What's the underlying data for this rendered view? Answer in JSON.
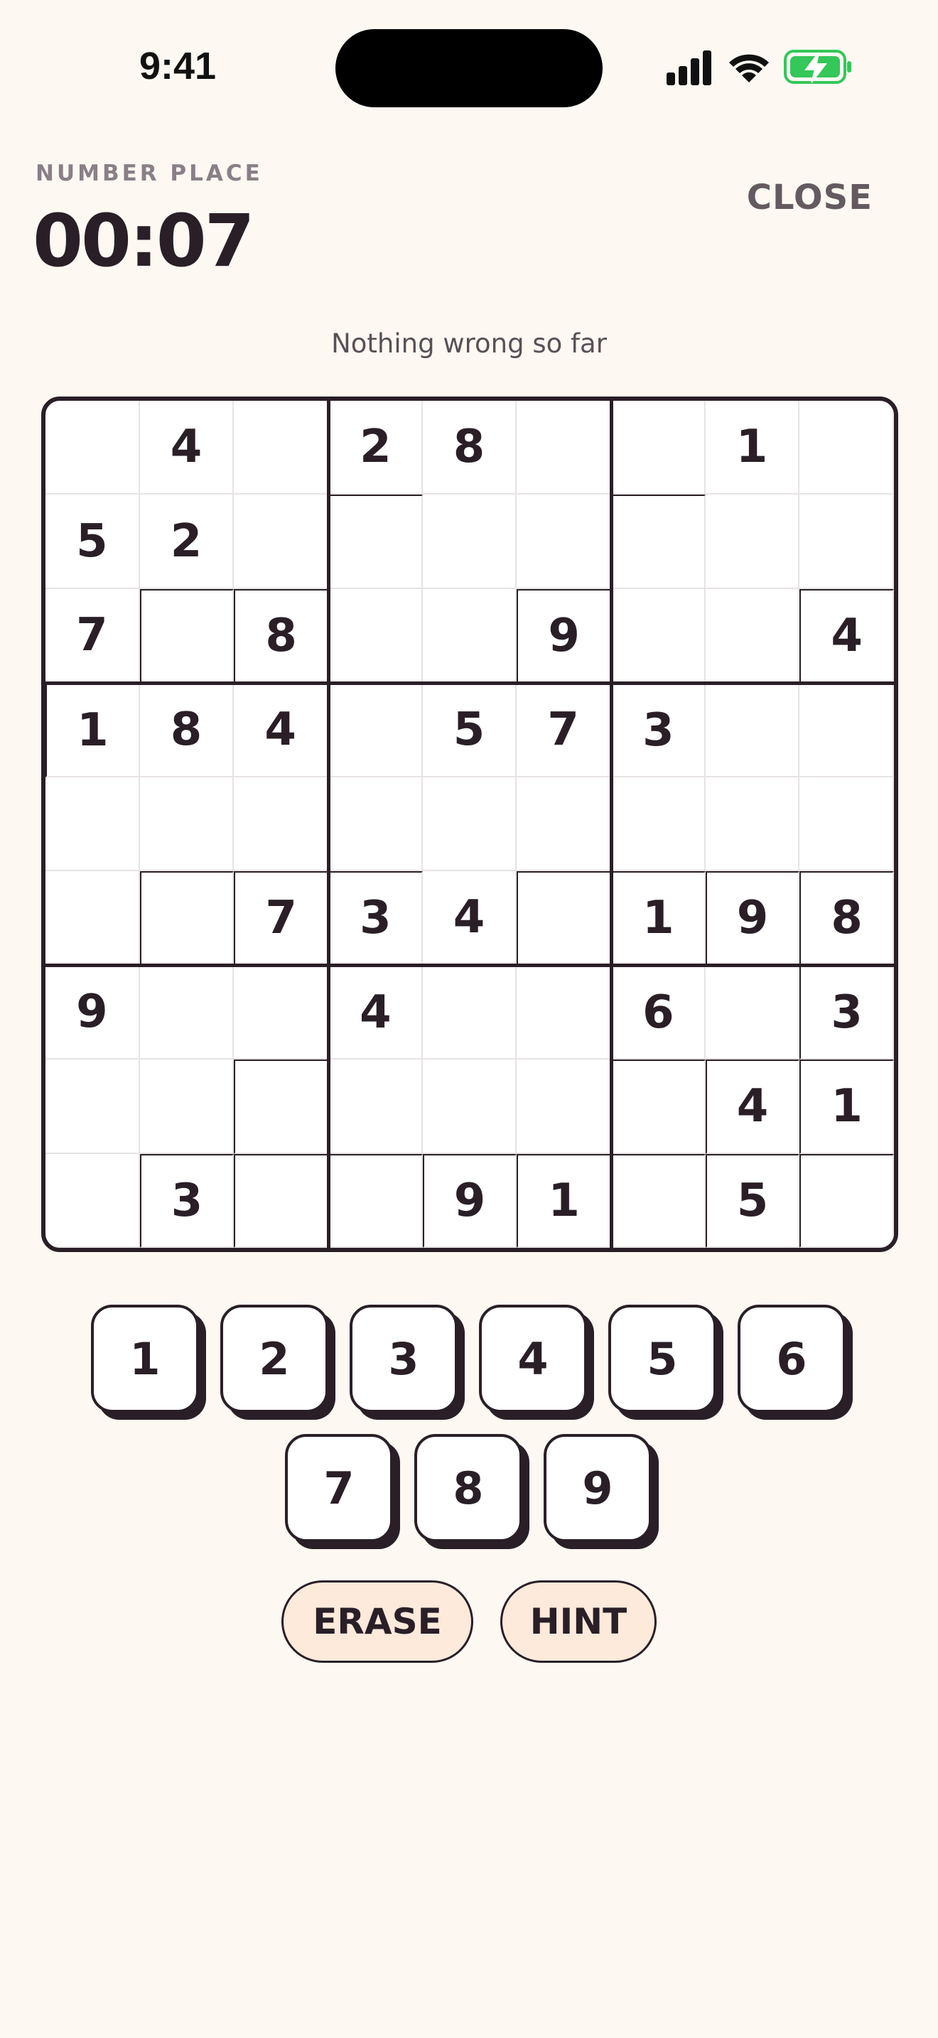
{
  "status_bar": {
    "time": "9:41",
    "icons": [
      "cellular-signal-icon",
      "wifi-icon",
      "battery-charging-icon"
    ],
    "battery_color": "#34c759"
  },
  "header": {
    "subtitle": "NUMBER PLACE",
    "timer": "00:07",
    "close_label": "CLOSE"
  },
  "status_message": "Nothing wrong so far",
  "board": {
    "rows": [
      [
        "",
        "4",
        "",
        "2",
        "8",
        "",
        "",
        "1",
        ""
      ],
      [
        "5",
        "2",
        "",
        "",
        "",
        "",
        "",
        "",
        ""
      ],
      [
        "7",
        "",
        "8",
        "",
        "",
        "9",
        "",
        "",
        "4"
      ],
      [
        "1",
        "8",
        "4",
        "",
        "5",
        "7",
        "3",
        "",
        ""
      ],
      [
        "",
        "",
        "",
        "",
        "",
        "",
        "",
        "",
        ""
      ],
      [
        "",
        "",
        "7",
        "3",
        "4",
        "",
        "1",
        "9",
        "8"
      ],
      [
        "9",
        "",
        "",
        "4",
        "",
        "",
        "6",
        "",
        "3"
      ],
      [
        "",
        "",
        "",
        "",
        "",
        "",
        "",
        "4",
        "1"
      ],
      [
        "",
        "3",
        "",
        "",
        "9",
        "1",
        "",
        "5",
        ""
      ]
    ]
  },
  "numpad": [
    "1",
    "2",
    "3",
    "4",
    "5",
    "6",
    "7",
    "8",
    "9"
  ],
  "actions": {
    "erase_label": "ERASE",
    "hint_label": "HINT"
  },
  "colors": {
    "background": "#fdf9f2",
    "ink": "#2a1f27",
    "action_fill": "#fdeadb",
    "muted_text": "#8a7f86"
  }
}
